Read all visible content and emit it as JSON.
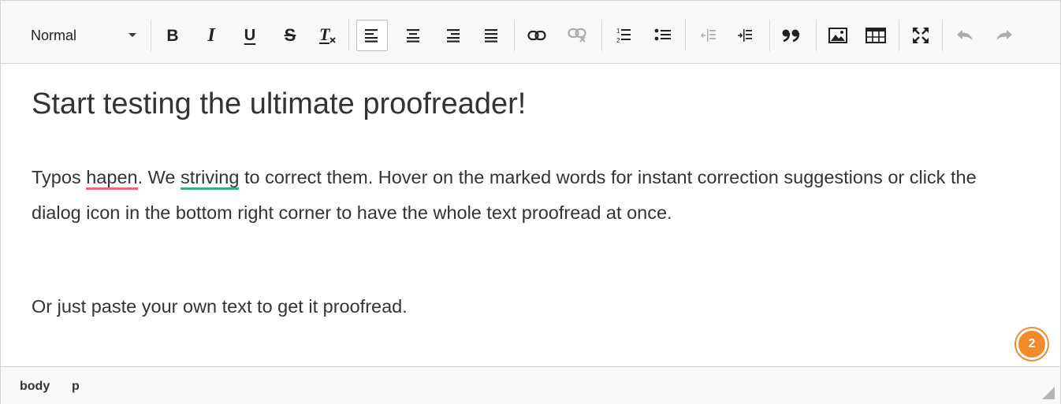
{
  "toolbar": {
    "format_select": {
      "value": "Normal"
    },
    "buttons": [
      {
        "name": "bold",
        "glyph": "B"
      },
      {
        "name": "italic",
        "glyph": "I"
      },
      {
        "name": "underline",
        "glyph": "U"
      },
      {
        "name": "strikethrough",
        "glyph": "S"
      },
      {
        "name": "remove-format",
        "glyph": "Tx"
      }
    ]
  },
  "content": {
    "heading": "Start testing the ultimate proofreader!",
    "paragraph1": {
      "before": "Typos ",
      "error1": "hapen",
      "middle": ". We ",
      "error2": "striving",
      "after": " to correct them. Hover on the marked words for instant correction suggestions or click the dialog icon in the bottom right corner to have the whole text proofread at once."
    },
    "paragraph2": "Or just paste your own text to get it proofread.",
    "badge_count": "2"
  },
  "statusbar": {
    "path": [
      "body",
      "p"
    ]
  },
  "colors": {
    "spelling_error": "#e86a6e",
    "grammar_error": "#3bab7a",
    "badge": "#f28a2b"
  }
}
